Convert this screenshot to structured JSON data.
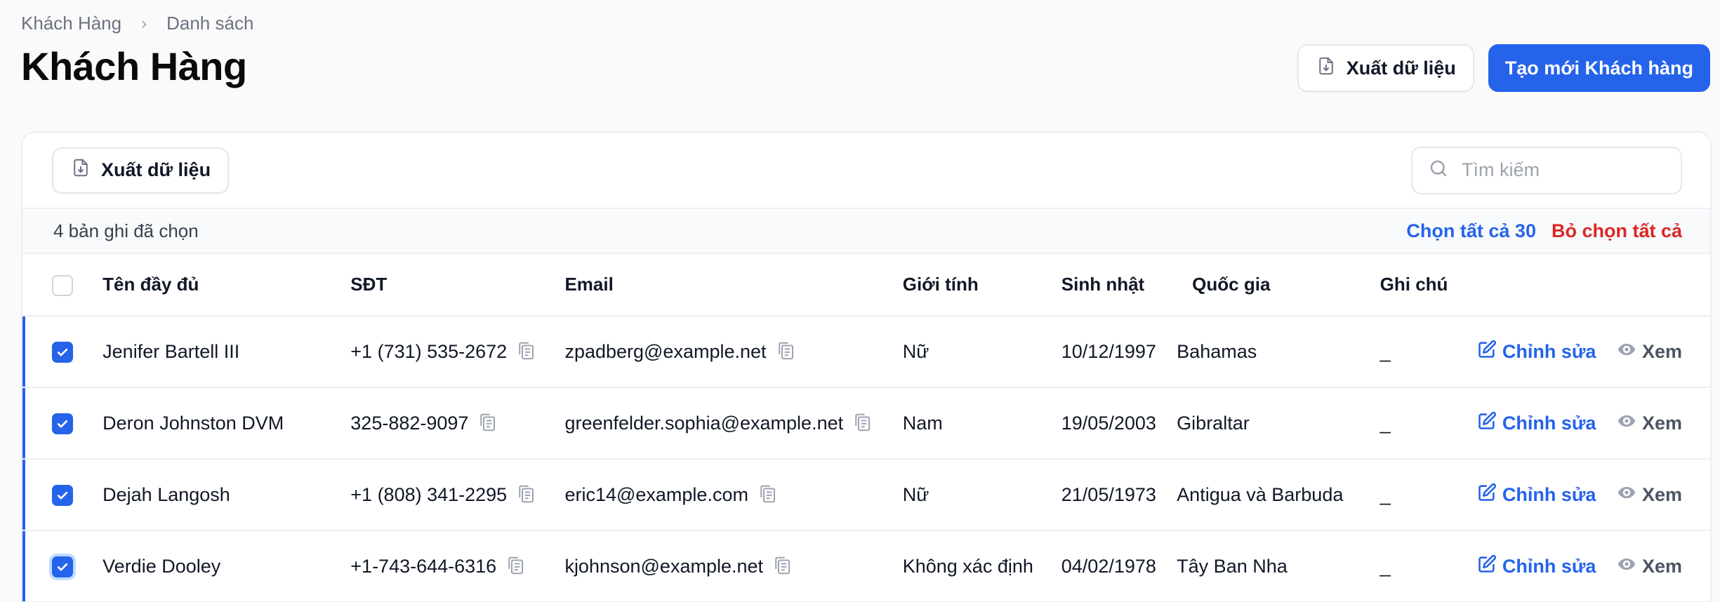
{
  "breadcrumb": [
    "Khách Hàng",
    "Danh sách"
  ],
  "page_title": "Khách Hàng",
  "header": {
    "export_label": "Xuất dữ liệu",
    "create_label": "Tạo mới Khách hàng"
  },
  "toolbar": {
    "export_label": "Xuất dữ liệu",
    "search_placeholder": "Tìm kiếm"
  },
  "selection": {
    "count_text": "4 bản ghi đã chọn",
    "select_all": "Chọn tất cả 30",
    "deselect_all": "Bỏ chọn tất cả"
  },
  "table": {
    "columns": [
      "Tên đầy đủ",
      "SĐT",
      "Email",
      "Giới tính",
      "Sinh nhật",
      "Quốc gia",
      "Ghi chú"
    ],
    "rows": [
      {
        "name": "Jenifer Bartell III",
        "phone": "+1 (731) 535-2672",
        "email": "zpadberg@example.net",
        "gender": "Nữ",
        "birthday": "10/12/1997",
        "country": "Bahamas",
        "note": "_"
      },
      {
        "name": "Deron Johnston DVM",
        "phone": "325-882-9097",
        "email": "greenfelder.sophia@example.net",
        "gender": "Nam",
        "birthday": "19/05/2003",
        "country": "Gibraltar",
        "note": "_"
      },
      {
        "name": "Dejah Langosh",
        "phone": "+1 (808) 341-2295",
        "email": "eric14@example.com",
        "gender": "Nữ",
        "birthday": "21/05/1973",
        "country": "Antigua và Barbuda",
        "note": "_"
      },
      {
        "name": "Verdie Dooley",
        "phone": "+1-743-644-6316",
        "email": "kjohnson@example.net",
        "gender": "Không xác định",
        "birthday": "04/02/1978",
        "country": "Tây Ban Nha",
        "note": "_"
      }
    ],
    "edit_label": "Chỉnh sửa",
    "view_label": "Xem"
  },
  "colors": {
    "accent": "#2563eb",
    "danger": "#dc2626"
  }
}
